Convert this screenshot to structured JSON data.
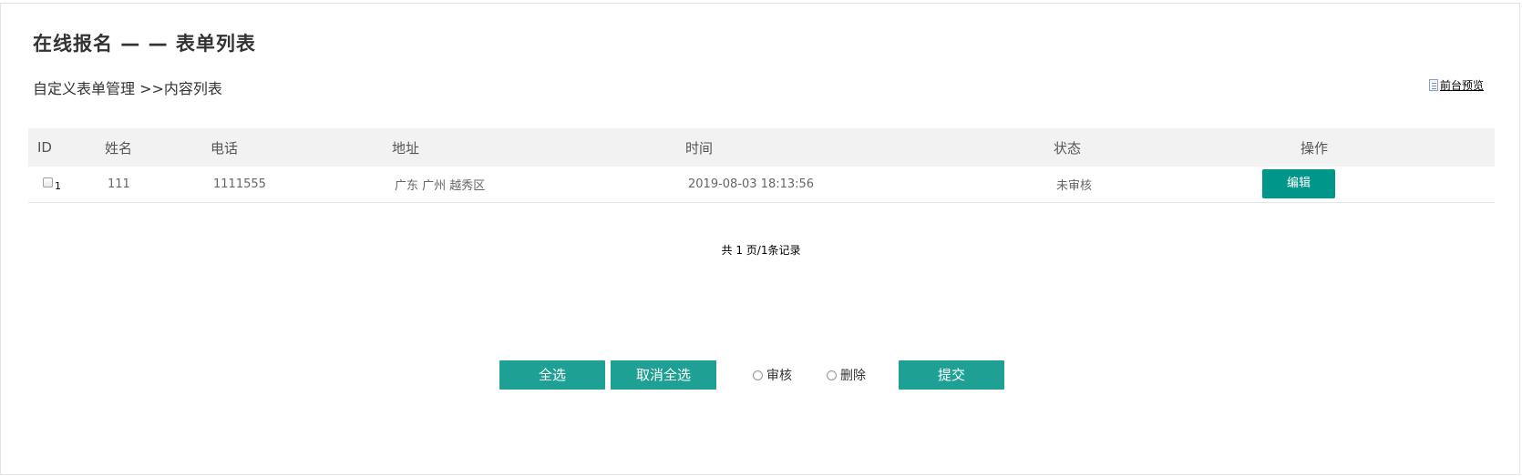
{
  "page": {
    "title": "在线报名 — — 表单列表",
    "breadcrumb": "自定义表单管理 >>内容列表",
    "preview_label": "前台预览"
  },
  "table": {
    "headers": [
      "ID",
      "姓名",
      "电话",
      "地址",
      "时间",
      "状态",
      "操作"
    ],
    "rows": [
      {
        "id": "1",
        "name": "111",
        "phone": "1111555",
        "address": "广东 广州 越秀区",
        "time": "2019-08-03 18:13:56",
        "status": "未审核",
        "action_label": "编辑"
      }
    ]
  },
  "pager": {
    "summary": "共 1 页/1条记录"
  },
  "actions": {
    "select_all": "全选",
    "deselect_all": "取消全选",
    "radio_review": "审核",
    "radio_delete": "删除",
    "submit": "提交"
  },
  "colors": {
    "accent": "#1ea194",
    "edit_button": "#00968a",
    "header_bg": "#f2f2f2"
  },
  "icons": {
    "preview": "document-icon"
  }
}
